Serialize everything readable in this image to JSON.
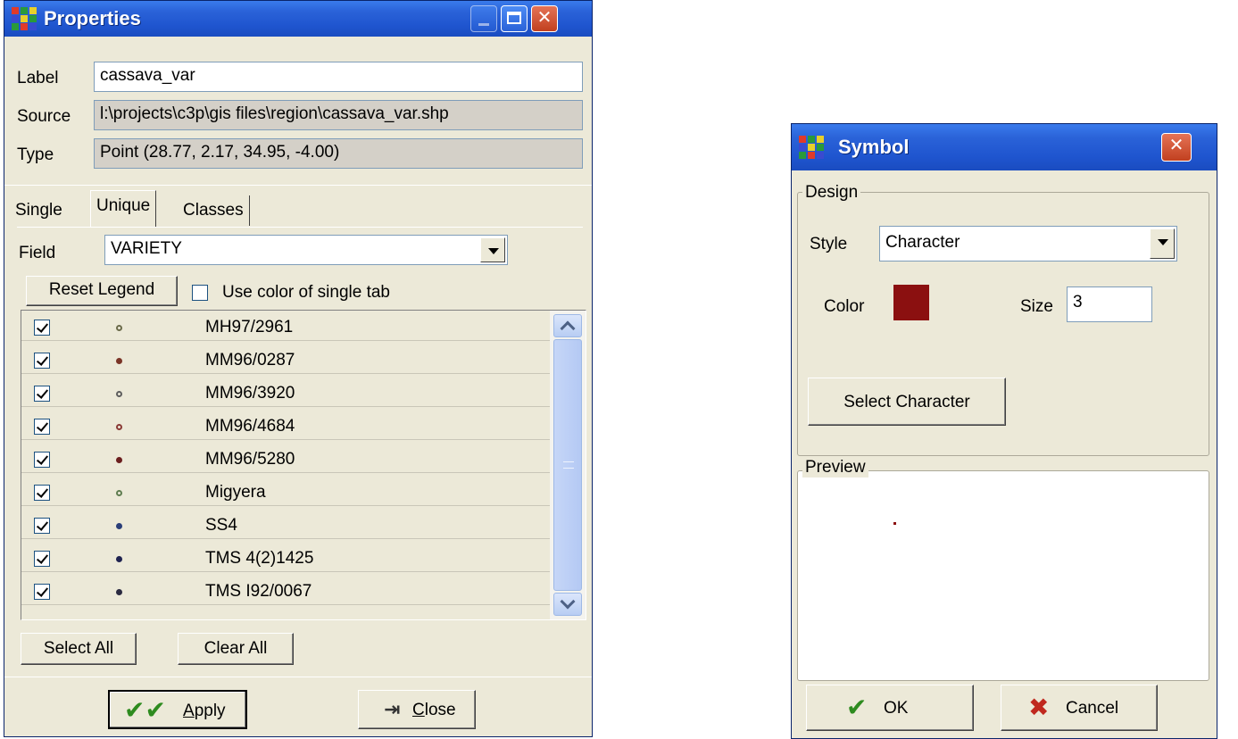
{
  "properties": {
    "title": "Properties",
    "label_caption": "Label",
    "label_value": "cassava_var",
    "source_caption": "Source",
    "source_value": "l:\\projects\\c3p\\gis files\\region\\cassava_var.shp",
    "type_caption": "Type",
    "type_value": "Point  (28.77, 2.17, 34.95, -4.00)",
    "tabs": [
      "Single",
      "Unique",
      "Classes"
    ],
    "field_caption": "Field",
    "field_value": "VARIETY",
    "reset_legend": "Reset Legend",
    "use_color_single": "Use color of single tab",
    "items": [
      {
        "label": "MH97/2961",
        "color": "#6b6b4a",
        "hollow": true
      },
      {
        "label": "MM96/0287",
        "color": "#7a3426",
        "hollow": false
      },
      {
        "label": "MM96/3920",
        "color": "#5e5e5e",
        "hollow": true
      },
      {
        "label": "MM96/4684",
        "color": "#8a3a36",
        "hollow": true
      },
      {
        "label": "MM96/5280",
        "color": "#6b1e1e",
        "hollow": false
      },
      {
        "label": "Migyera",
        "color": "#5f7d50",
        "hollow": true
      },
      {
        "label": "SS4",
        "color": "#2a3e78",
        "hollow": false
      },
      {
        "label": "TMS 4(2)1425",
        "color": "#1f2350",
        "hollow": false
      },
      {
        "label": "TMS I92/0067",
        "color": "#2a2a40",
        "hollow": false
      }
    ],
    "select_all": "Select All",
    "clear_all": "Clear All",
    "apply_prefix": "",
    "apply_mnemonic": "A",
    "apply_rest": "pply",
    "close_mnemonic": "C",
    "close_rest": "lose",
    "check_color": "#2e8b1f"
  },
  "symbol": {
    "title": "Symbol",
    "design_group": "Design",
    "style_caption": "Style",
    "style_value": "Character",
    "color_caption": "Color",
    "color_swatch": "#8b1010",
    "size_caption": "Size",
    "size_value": "3",
    "select_character": "Select Character",
    "preview_group": "Preview",
    "ok_label": "OK",
    "cancel_label": "Cancel",
    "ok_color": "#2e8b1f",
    "cancel_color": "#c0281e"
  }
}
